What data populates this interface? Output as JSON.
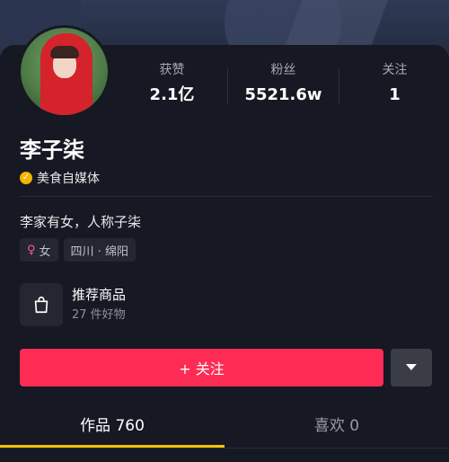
{
  "profile": {
    "name": "李子柒",
    "verify_label": "美食自媒体",
    "bio": "李家有女，人称子柒",
    "tags": {
      "gender": "女",
      "location": "四川 · 绵阳"
    }
  },
  "stats": [
    {
      "label": "获赞",
      "value": "2.1亿"
    },
    {
      "label": "粉丝",
      "value": "5521.6w"
    },
    {
      "label": "关注",
      "value": "1"
    }
  ],
  "shop": {
    "title": "推荐商品",
    "subtitle": "27 件好物"
  },
  "actions": {
    "follow_label": "+ 关注"
  },
  "tabs": [
    {
      "label": "作品 760"
    },
    {
      "label": "喜欢 0"
    }
  ],
  "colors": {
    "background": "#161823",
    "accent": "#fe2c55",
    "tab_indicator": "#f4c400",
    "verify_badge": "#f5b400"
  },
  "icons": [
    "check-icon",
    "female-icon",
    "shopping-bag-icon",
    "chevron-down-icon"
  ]
}
